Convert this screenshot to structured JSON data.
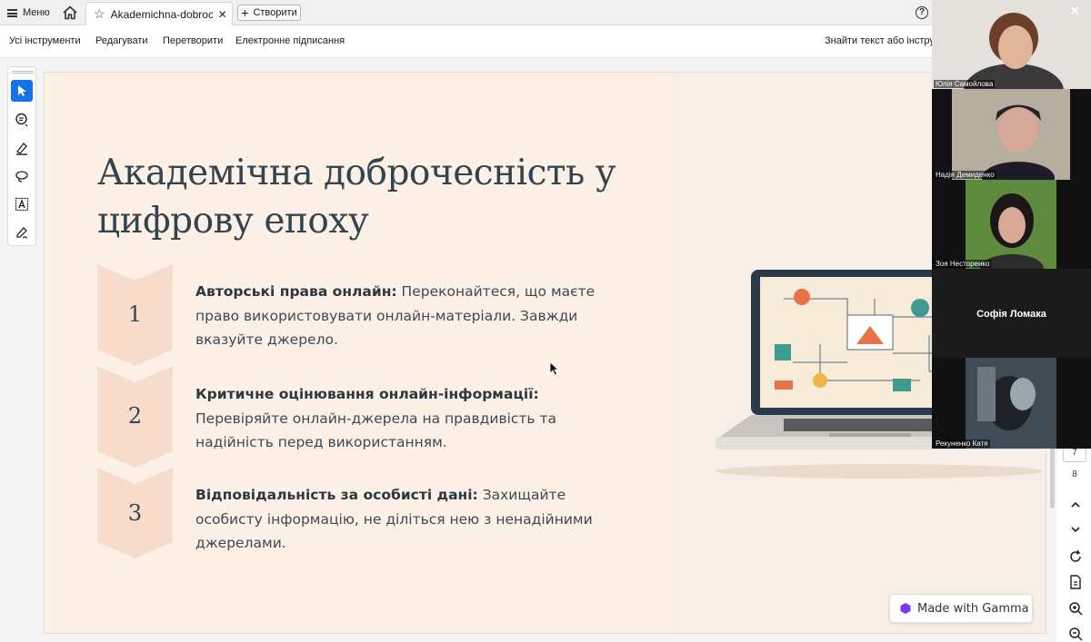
{
  "tabbar": {
    "menu_label": "Меню",
    "tab_title": "Akademichna-dobroc...",
    "create_label": "Створити",
    "help_icon": "help-circle-icon",
    "home_icon": "home-icon"
  },
  "toolsbar": {
    "items": [
      "Усі інструменти",
      "Редагувати",
      "Перетворити",
      "Електронне підписання"
    ],
    "find_text": "Знайти текст або інструм"
  },
  "left_tools": [
    "select-icon",
    "comment-icon",
    "highlight-pen-icon",
    "lasso-draw-icon",
    "text-select-icon",
    "sign-pen-icon"
  ],
  "slide": {
    "title_line1": "Академічна доброчесність у",
    "title_line2": "цифрову епоху",
    "items": [
      {
        "num": "1",
        "bold": "Авторські права онлайн:",
        "text": " Переконайтеся, що маєте право використовувати онлайн-матеріали. Завжди вказуйте джерело."
      },
      {
        "num": "2",
        "bold": "Критичне оцінювання онлайн-інформації:",
        "text": " Перевіряйте онлайн-джерела на правдивість та надійність перед використанням."
      },
      {
        "num": "3",
        "bold": "Відповідальність за особисті дані:",
        "text": " Захищайте особисту інформацію, не діліться нею з ненадійними джерелами."
      }
    ],
    "badge_label": "Made with Gamma"
  },
  "page_nav": {
    "page_current": "7",
    "page_next": "8"
  },
  "participants": [
    {
      "name": "Юлія Самойлова"
    },
    {
      "name": "Надія Демиденко"
    },
    {
      "name": "Зоя Несторенко"
    },
    {
      "name": "Софія Ломака"
    },
    {
      "name": "Рекуненко Катя"
    }
  ],
  "colors": {
    "accent": "#1473e6",
    "slide_bg": "#fdf1e7",
    "chevron": "#f8dccb",
    "title": "#34444d"
  }
}
